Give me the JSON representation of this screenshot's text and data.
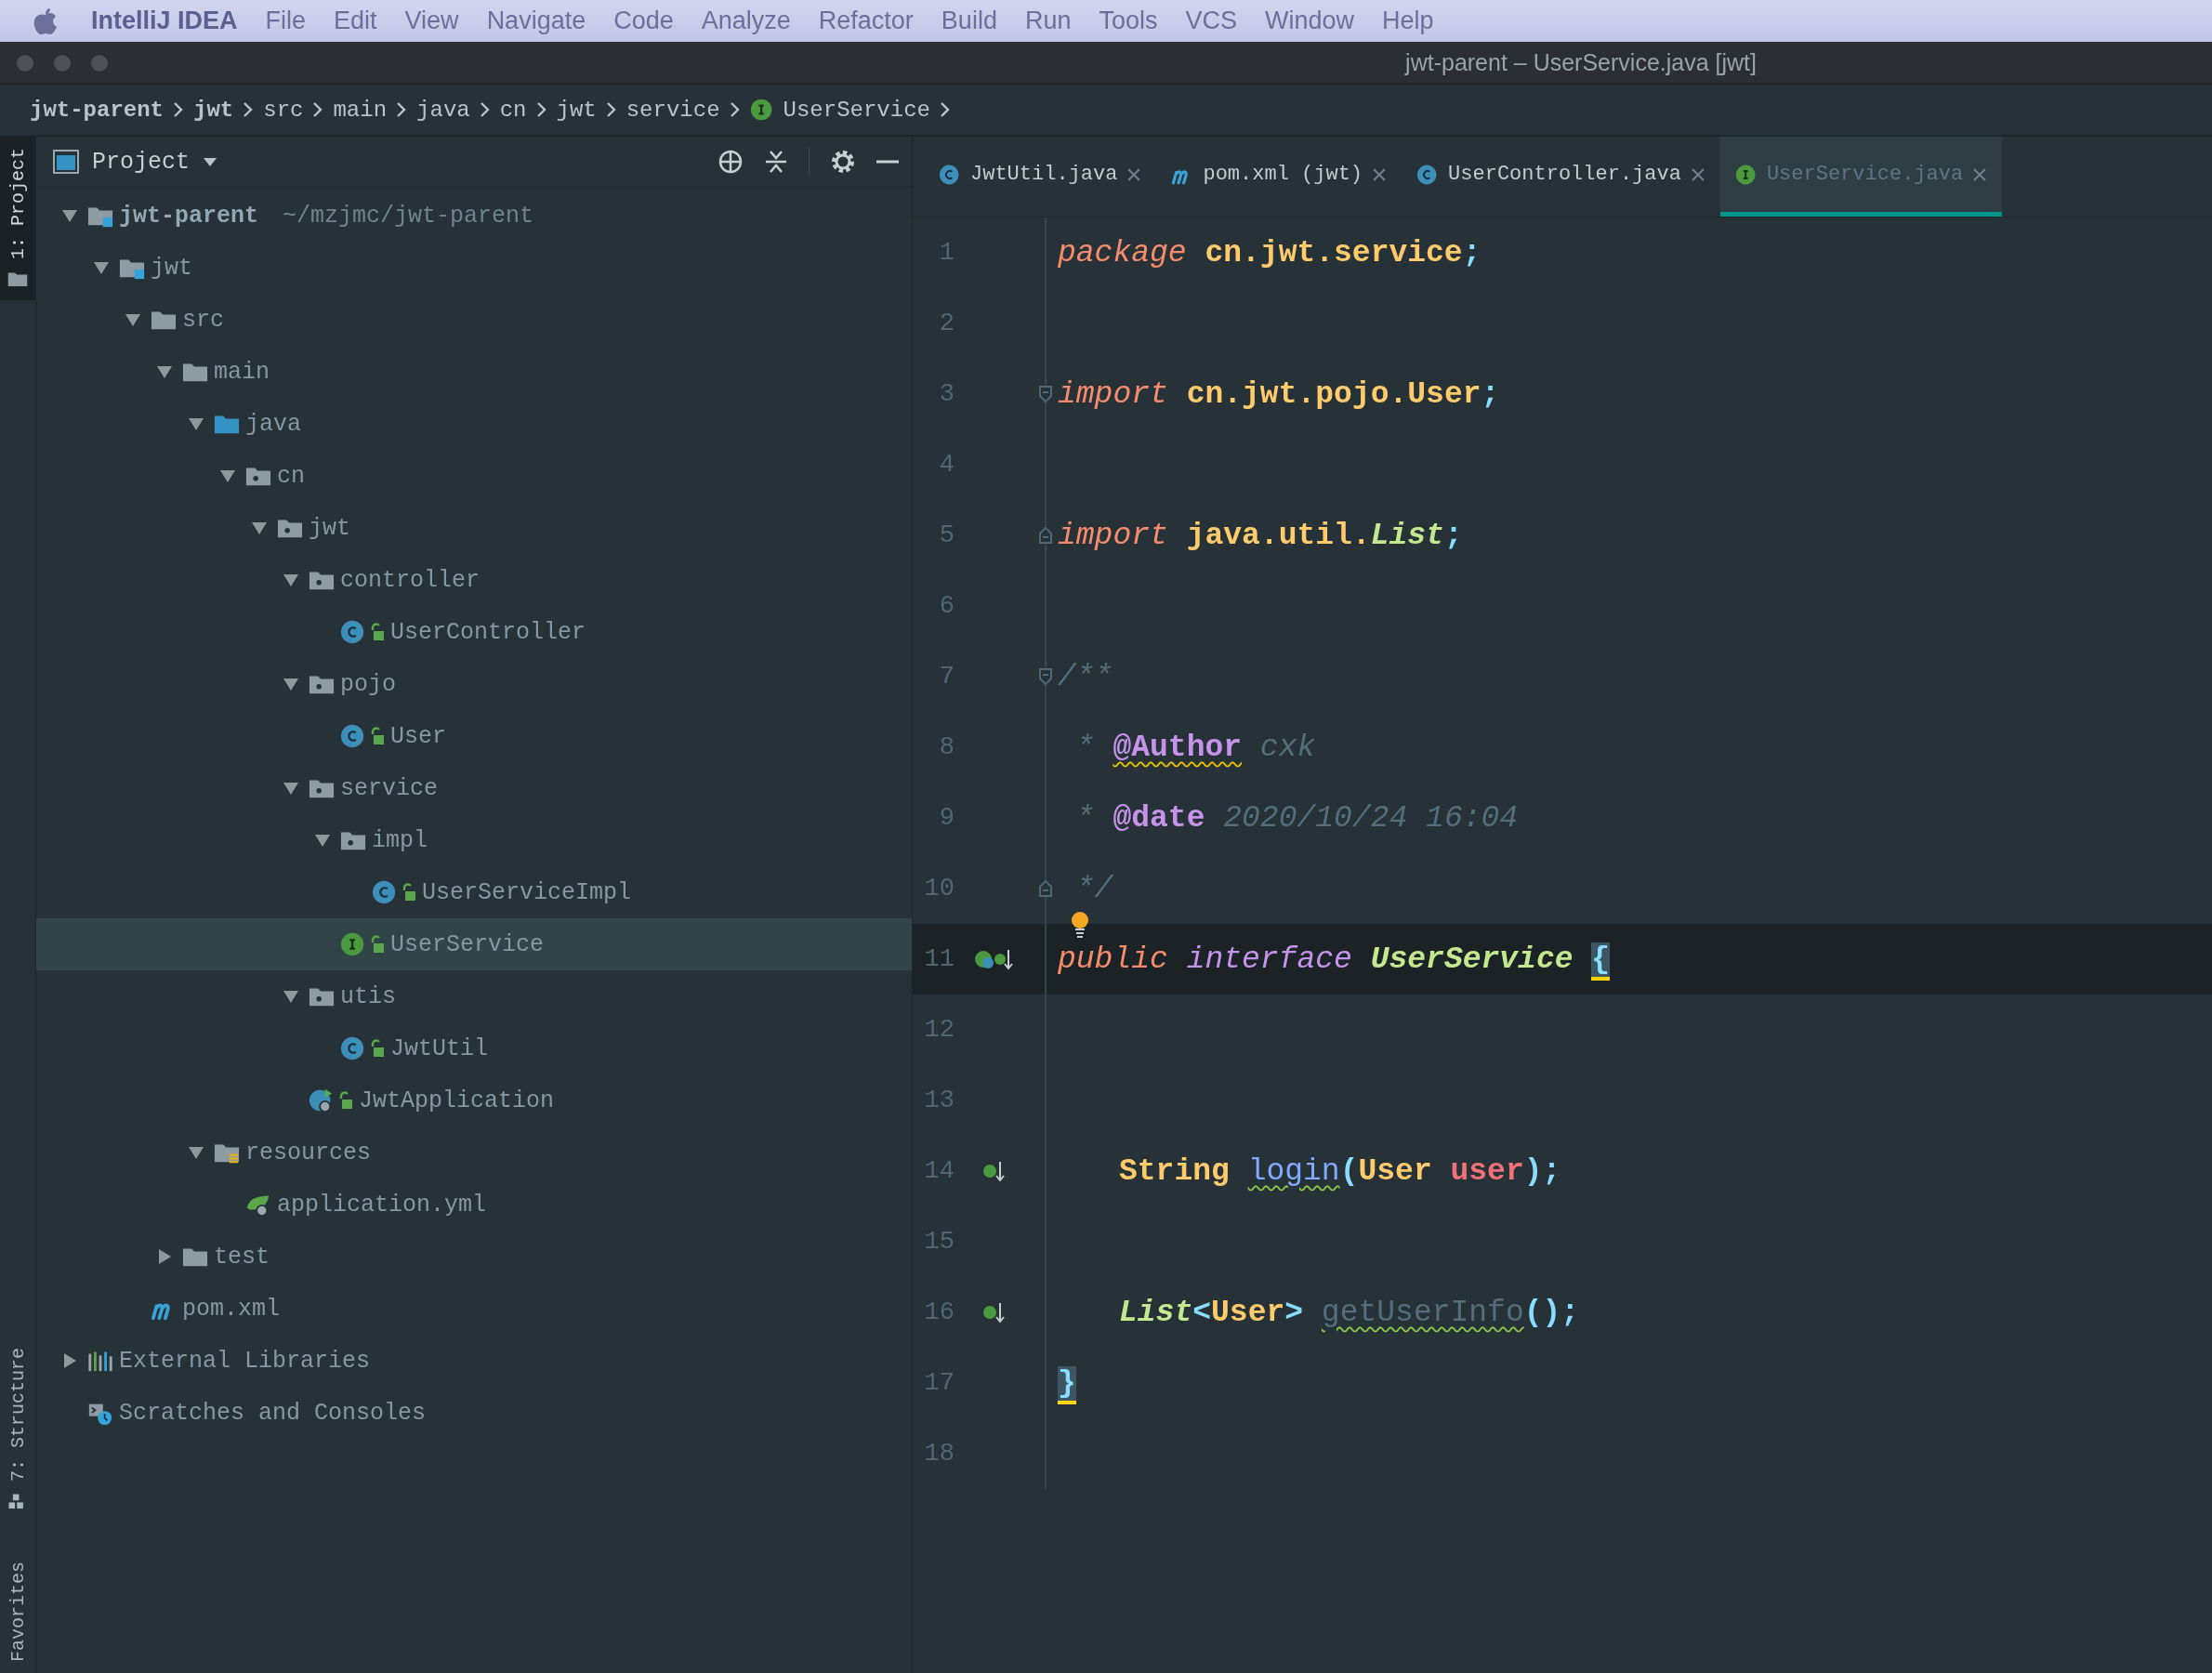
{
  "menu_bar": {
    "app_name": "IntelliJ IDEA",
    "items": [
      "File",
      "Edit",
      "View",
      "Navigate",
      "Code",
      "Analyze",
      "Refactor",
      "Build",
      "Run",
      "Tools",
      "VCS",
      "Window",
      "Help"
    ]
  },
  "window": {
    "title": "jwt-parent – UserService.java [jwt]"
  },
  "breadcrumbs": [
    {
      "label": "jwt-parent",
      "bold": true
    },
    {
      "label": "jwt",
      "bold": true
    },
    {
      "label": "src",
      "bold": false
    },
    {
      "label": "main",
      "bold": false
    },
    {
      "label": "java",
      "bold": false
    },
    {
      "label": "cn",
      "bold": false
    },
    {
      "label": "jwt",
      "bold": false
    },
    {
      "label": "service",
      "bold": false
    },
    {
      "label": "UserService",
      "bold": false,
      "kind": "interface"
    }
  ],
  "tool_stripe": [
    {
      "label": "1: Project",
      "selected": true
    },
    {
      "label": "7: Structure",
      "selected": false
    },
    {
      "label": "Favorites",
      "selected": false
    }
  ],
  "project_panel": {
    "title": "Project",
    "tree": [
      {
        "label": "jwt-parent",
        "hint": "~/mzjmc/jwt-parent",
        "kind": "module",
        "expanded": true,
        "selected": false,
        "children": [
          {
            "label": "jwt",
            "kind": "module",
            "expanded": true,
            "selected": false,
            "children": [
              {
                "label": "src",
                "kind": "folder",
                "expanded": true,
                "selected": false,
                "children": [
                  {
                    "label": "main",
                    "kind": "folder",
                    "expanded": true,
                    "selected": false,
                    "children": [
                      {
                        "label": "java",
                        "kind": "source",
                        "expanded": true,
                        "selected": false,
                        "children": [
                          {
                            "label": "cn",
                            "kind": "package",
                            "expanded": true,
                            "selected": false,
                            "children": [
                              {
                                "label": "jwt",
                                "kind": "package",
                                "expanded": true,
                                "selected": false,
                                "children": [
                                  {
                                    "label": "controller",
                                    "kind": "package",
                                    "expanded": true,
                                    "selected": false,
                                    "children": [
                                      {
                                        "label": "UserController",
                                        "kind": "class",
                                        "selected": false
                                      }
                                    ]
                                  },
                                  {
                                    "label": "pojo",
                                    "kind": "package",
                                    "expanded": true,
                                    "selected": false,
                                    "children": [
                                      {
                                        "label": "User",
                                        "kind": "class",
                                        "selected": false
                                      }
                                    ]
                                  },
                                  {
                                    "label": "service",
                                    "kind": "package",
                                    "expanded": true,
                                    "selected": false,
                                    "children": [
                                      {
                                        "label": "impl",
                                        "kind": "package",
                                        "expanded": true,
                                        "selected": false,
                                        "children": [
                                          {
                                            "label": "UserServiceImpl",
                                            "kind": "class",
                                            "selected": false
                                          }
                                        ]
                                      },
                                      {
                                        "label": "UserService",
                                        "kind": "interface",
                                        "selected": true
                                      }
                                    ]
                                  },
                                  {
                                    "label": "utis",
                                    "kind": "package",
                                    "expanded": true,
                                    "selected": false,
                                    "children": [
                                      {
                                        "label": "JwtUtil",
                                        "kind": "class",
                                        "selected": false
                                      }
                                    ]
                                  },
                                  {
                                    "label": "JwtApplication",
                                    "kind": "spring-app",
                                    "selected": false
                                  }
                                ]
                              }
                            ]
                          }
                        ]
                      },
                      {
                        "label": "resources",
                        "kind": "resources",
                        "expanded": true,
                        "selected": false,
                        "children": [
                          {
                            "label": "application.yml",
                            "kind": "spring-config",
                            "selected": false
                          }
                        ]
                      }
                    ]
                  },
                  {
                    "label": "test",
                    "kind": "folder",
                    "expanded": false,
                    "selected": false
                  }
                ]
              },
              {
                "label": "pom.xml",
                "kind": "maven",
                "selected": false
              }
            ]
          }
        ]
      },
      {
        "label": "External Libraries",
        "kind": "libraries",
        "expanded": false,
        "selected": false
      },
      {
        "label": "Scratches and Consoles",
        "kind": "scratches",
        "selected": false
      }
    ]
  },
  "editor_tabs": [
    {
      "label": "JwtUtil.java",
      "kind": "class",
      "selected": false
    },
    {
      "label": "pom.xml (jwt)",
      "kind": "maven",
      "selected": false
    },
    {
      "label": "UserController.java",
      "kind": "class",
      "selected": false
    },
    {
      "label": "UserService.java",
      "kind": "interface",
      "selected": true
    }
  ],
  "editor_lines": [
    {
      "number": "1",
      "current": false,
      "tokens": [
        {
          "kind": "keyword",
          "text": "package"
        },
        {
          "kind": "ident",
          "text": " cn.jwt.service"
        },
        {
          "kind": "punct",
          "text": ";"
        }
      ]
    },
    {
      "number": "2",
      "current": false
    },
    {
      "number": "3",
      "current": false,
      "fold_start": true,
      "tokens": [
        {
          "kind": "keyword",
          "text": "import"
        },
        {
          "kind": "ident",
          "text": " cn.jwt.pojo.User"
        },
        {
          "kind": "punct",
          "text": ";"
        }
      ]
    },
    {
      "number": "4",
      "current": false
    },
    {
      "number": "5",
      "current": false,
      "fold_end": true,
      "tokens": [
        {
          "kind": "keyword",
          "text": "import"
        },
        {
          "kind": "ident",
          "text": " java.util."
        },
        {
          "kind": "type",
          "text": "List"
        },
        {
          "kind": "punct",
          "text": ";"
        }
      ]
    },
    {
      "number": "6",
      "current": false
    },
    {
      "number": "7",
      "current": false,
      "fold_start": true,
      "tokens": [
        {
          "kind": "comment",
          "text": "/**"
        }
      ]
    },
    {
      "number": "8",
      "current": false,
      "tokens": [
        {
          "kind": "comment",
          "text": " * "
        },
        {
          "kind": "doc-tag",
          "text": "@Author",
          "squiggle": true
        },
        {
          "kind": "comment",
          "text": " cxk"
        }
      ]
    },
    {
      "number": "9",
      "current": false,
      "tokens": [
        {
          "kind": "comment",
          "text": " * "
        },
        {
          "kind": "doc-tag",
          "text": "@date"
        },
        {
          "kind": "comment",
          "text": " 2020/10/24 16:04"
        }
      ]
    },
    {
      "number": "10",
      "current": false,
      "fold_end": true,
      "bulb": true,
      "tokens": [
        {
          "kind": "comment",
          "text": " */"
        }
      ]
    },
    {
      "number": "11",
      "current": true,
      "implemented_mark": true,
      "tokens": [
        {
          "kind": "keyword",
          "text": "public"
        },
        {
          "kind": "modifier",
          "text": " interface"
        },
        {
          "kind": "class",
          "text": " UserService "
        },
        {
          "kind": "brace",
          "text": "{"
        }
      ]
    },
    {
      "number": "12",
      "current": false
    },
    {
      "number": "13",
      "current": false
    },
    {
      "number": "14",
      "current": false,
      "implementing_mark": true,
      "indented": true,
      "tokens": [
        {
          "kind": "ident",
          "text": "String "
        },
        {
          "kind": "method",
          "text": "login",
          "squiggle": true
        },
        {
          "kind": "punct",
          "text": "("
        },
        {
          "kind": "ident",
          "text": "User"
        },
        {
          "kind": "param",
          "text": " user"
        },
        {
          "kind": "punct",
          "text": ");"
        }
      ]
    },
    {
      "number": "15",
      "current": false
    },
    {
      "number": "16",
      "current": false,
      "implementing_mark": true,
      "indented": true,
      "tokens": [
        {
          "kind": "type",
          "text": "List"
        },
        {
          "kind": "punct",
          "text": "<"
        },
        {
          "kind": "ident",
          "text": "User"
        },
        {
          "kind": "punct",
          "text": "> "
        },
        {
          "kind": "unused",
          "text": "getUserInfo",
          "squiggle": true
        },
        {
          "kind": "punct",
          "text": "();"
        }
      ]
    },
    {
      "number": "17",
      "current": false,
      "tokens": [
        {
          "kind": "brace",
          "text": "}"
        }
      ]
    },
    {
      "number": "18",
      "current": false
    }
  ]
}
